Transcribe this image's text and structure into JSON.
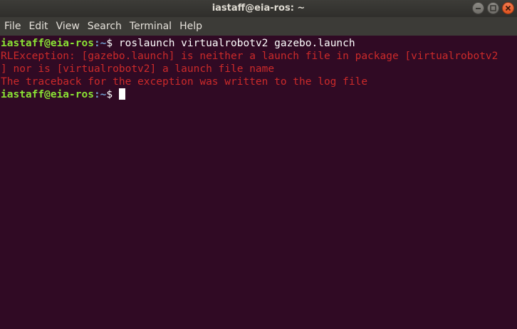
{
  "window": {
    "title": "iastaff@eia-ros: ~"
  },
  "menu": {
    "items": [
      "File",
      "Edit",
      "View",
      "Search",
      "Terminal",
      "Help"
    ]
  },
  "terminal": {
    "prompt1": {
      "user_host": "iastaff@eia-ros",
      "path": ":~",
      "symbol": "$",
      "command": " roslaunch virtualrobotv2 gazebo.launch"
    },
    "output": [
      "RLException: [gazebo.launch] is neither a launch file in package [virtualrobotv2",
      "] nor is [virtualrobotv2] a launch file name",
      "The traceback for the exception was written to the log file"
    ],
    "prompt2": {
      "user_host": "iastaff@eia-ros",
      "path": ":~",
      "symbol": "$ "
    }
  },
  "colors": {
    "background": "#300a24",
    "prompt_user": "#8ae234",
    "prompt_path": "#729fcf",
    "error": "#cc2a2a"
  },
  "icons": {
    "minimize": "minimize-icon",
    "maximize": "maximize-icon",
    "close": "close-icon"
  }
}
